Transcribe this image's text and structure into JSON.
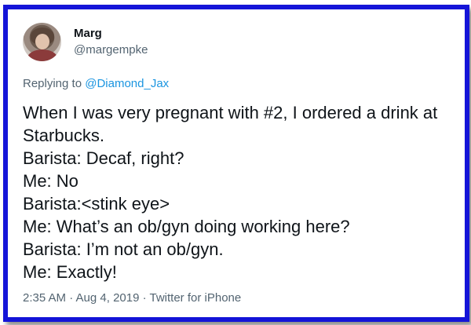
{
  "author": {
    "display_name": "Marg",
    "handle": "@margempke"
  },
  "reply": {
    "prefix": "Replying to ",
    "mention": "@Diamond_Jax"
  },
  "tweet": {
    "lines": [
      "When I was very pregnant with #2, I ordered a drink at Starbucks.",
      "Barista: Decaf, right?",
      "Me: No",
      "Barista:<stink eye>",
      "Me: What’s an ob/gyn doing working here?",
      "Barista: I’m not an ob/gyn.",
      "Me: Exactly!"
    ]
  },
  "meta": {
    "text": "2:35 AM · Aug 4, 2019 · Twitter for iPhone"
  },
  "colors": {
    "frame_border": "#1414d8",
    "mention": "#1b95e0",
    "secondary_text": "#536471",
    "primary_text": "#0f1419"
  },
  "icons": {
    "avatar": "profile-photo"
  }
}
